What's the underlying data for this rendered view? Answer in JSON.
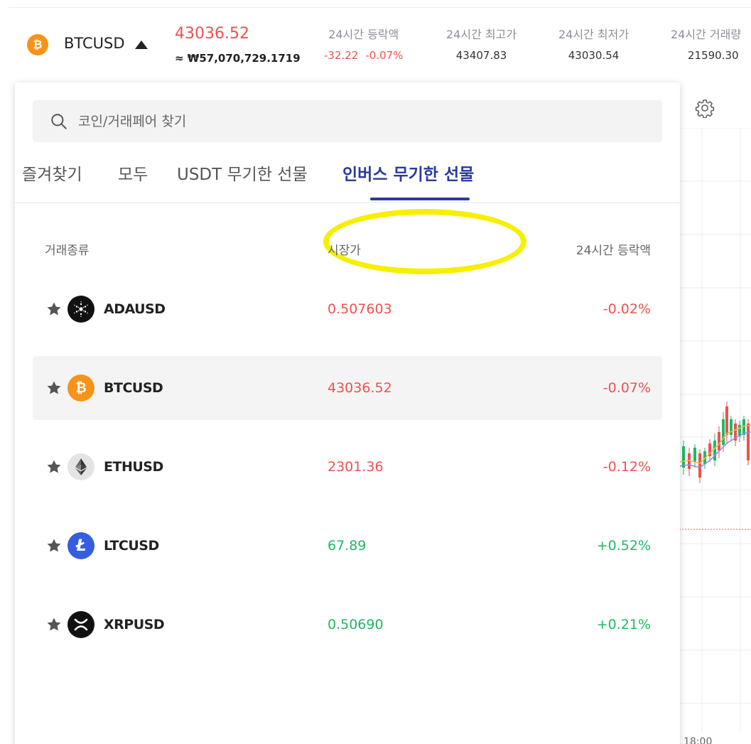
{
  "ticker": {
    "symbol": "BTCUSD",
    "coin_icon": "bitcoin-icon",
    "price": "43036.52",
    "krw_price": "≈ ₩57,070,729.1719",
    "stats": [
      {
        "label": "24시간 등락액",
        "change": "-32.22",
        "percent": "-0.07%"
      },
      {
        "label": "24시간 최고가",
        "value": "43407.83"
      },
      {
        "label": "24시간 최저가",
        "value": "43030.54"
      },
      {
        "label": "24시간 거래량",
        "value": "21590.30"
      }
    ]
  },
  "search": {
    "placeholder": "코인/거래페어 찾기",
    "value": ""
  },
  "tabs": [
    {
      "label": "즐겨찾기",
      "active": false
    },
    {
      "label": "모두",
      "active": false
    },
    {
      "label": "USDT 무기한 선물",
      "active": false
    },
    {
      "label": "인버스 무기한 선물",
      "active": true
    }
  ],
  "columns": {
    "pair": "거래종류",
    "price": "시장가",
    "change": "24시간 등락액"
  },
  "rows": [
    {
      "symbol": "ADAUSD",
      "icon": "cardano-icon",
      "price": "0.507603",
      "change": "-0.02%",
      "direction": "down",
      "selected": false
    },
    {
      "symbol": "BTCUSD",
      "icon": "bitcoin-icon",
      "price": "43036.52",
      "change": "-0.07%",
      "direction": "down",
      "selected": true
    },
    {
      "symbol": "ETHUSD",
      "icon": "ethereum-icon",
      "price": "2301.36",
      "change": "-0.12%",
      "direction": "down",
      "selected": false
    },
    {
      "symbol": "LTCUSD",
      "icon": "litecoin-icon",
      "price": "67.89",
      "change": "+0.52%",
      "direction": "up",
      "selected": false
    },
    {
      "symbol": "XRPUSD",
      "icon": "xrp-icon",
      "price": "0.50690",
      "change": "+0.21%",
      "direction": "up",
      "selected": false
    }
  ],
  "chart": {
    "time_label": "18:00"
  },
  "colors": {
    "up": "#1fb866",
    "down": "#f0504f",
    "active_tab": "#2a3a9e",
    "highlight": "#f6f000"
  }
}
